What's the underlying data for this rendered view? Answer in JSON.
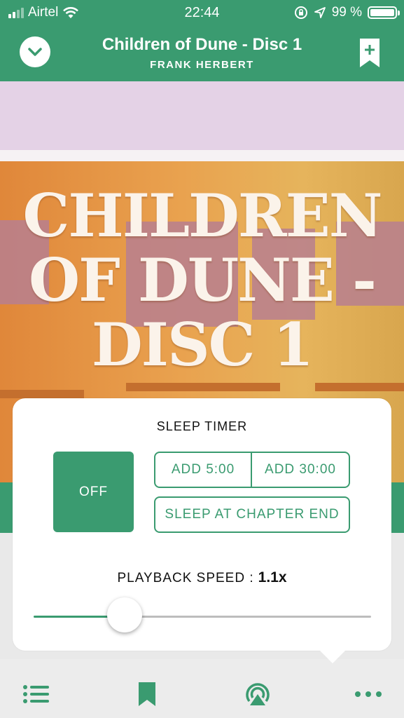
{
  "status_bar": {
    "carrier": "Airtel",
    "time": "22:44",
    "battery_text": "99 %",
    "battery_level": 0.99
  },
  "header": {
    "title": "Children of Dune - Disc 1",
    "author": "FRANK HERBERT"
  },
  "cover": {
    "title_lines": [
      "CHILDREN",
      "OF DUNE -",
      "DISC 1"
    ]
  },
  "sleep_timer": {
    "title": "SLEEP TIMER",
    "off_label": "OFF",
    "add5_label": "ADD 5:00",
    "add30_label": "ADD 30:00",
    "chapter_end_label": "SLEEP AT CHAPTER END"
  },
  "playback": {
    "label": "PLAYBACK SPEED :",
    "value": "1.1x",
    "slider_fraction": 0.27
  },
  "colors": {
    "accent": "#3a9b70",
    "status_bar": "#3a9b70",
    "bottom_bar": "#ececec"
  },
  "icons": {
    "collapse": "chevron-down-icon",
    "add_bookmark": "bookmark-plus-icon",
    "chapters": "list-icon",
    "bookmarks": "bookmark-icon",
    "airplay": "airplay-icon",
    "more": "more-dots-icon"
  }
}
